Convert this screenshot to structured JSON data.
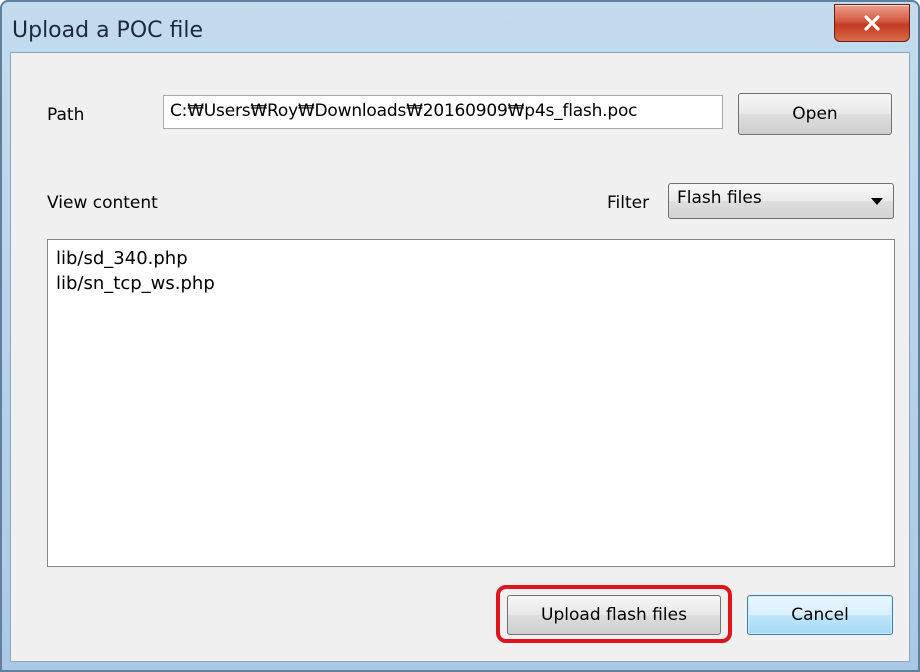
{
  "window": {
    "title": "Upload a POC file"
  },
  "path": {
    "label": "Path",
    "value": "C:\\Users\\Roy\\Downloads\\20160909\\p4s_flash.poc",
    "display_value": "C:₩Users₩Roy₩Downloads₩20160909₩p4s_flash.poc",
    "open_label": "Open"
  },
  "content": {
    "label": "View content",
    "filter_label": "Filter",
    "filter_selected": "Flash files",
    "items": [
      "lib/sd_340.php",
      "lib/sn_tcp_ws.php"
    ]
  },
  "actions": {
    "upload_label": "Upload flash files",
    "cancel_label": "Cancel"
  },
  "colors": {
    "highlight": "#e0141c",
    "close_button": "#c23a22",
    "titlebar": "#b5d1e9"
  },
  "icons": {
    "close": "close-icon",
    "dropdown": "chevron-down-icon"
  }
}
